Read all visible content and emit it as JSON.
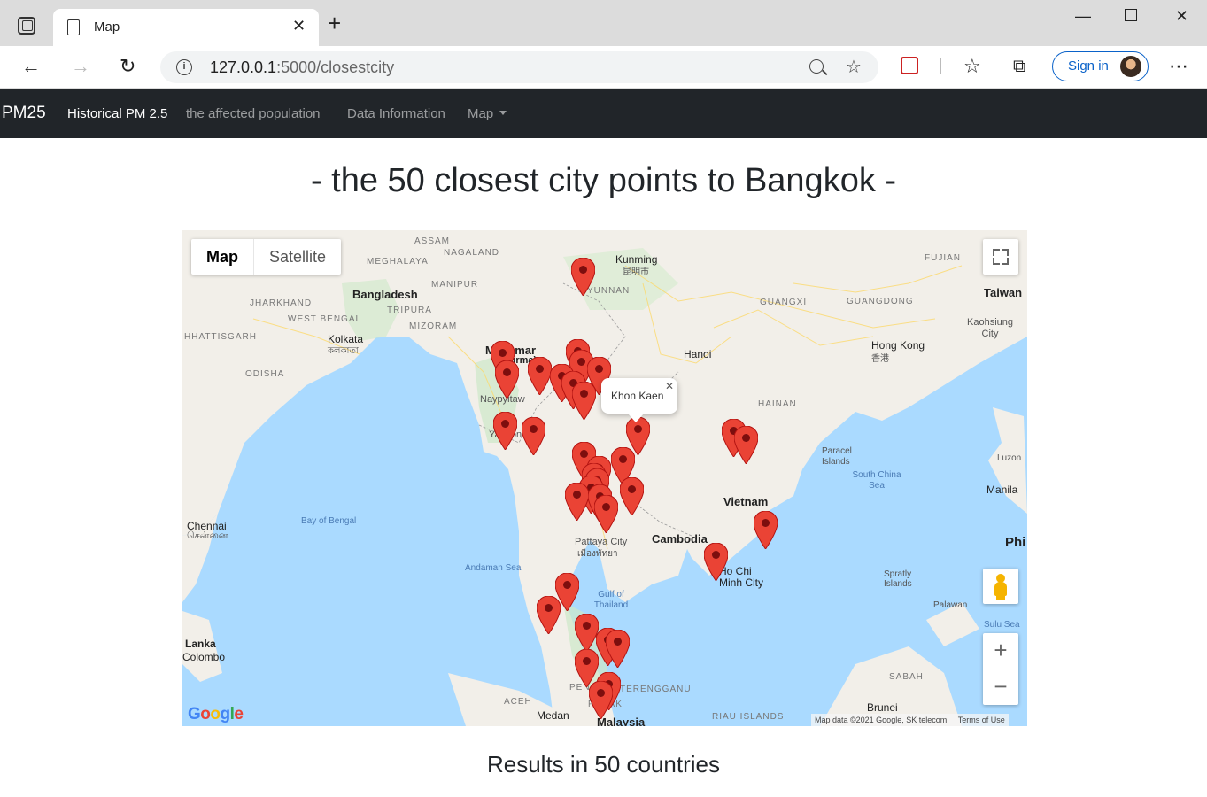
{
  "browser": {
    "tab_title": "Map",
    "url_host": "127.0.0.1",
    "url_path": ":5000/closestcity",
    "signin_label": "Sign in"
  },
  "navbar": {
    "brand": "PM25",
    "items": [
      {
        "label": "Historical PM 2.5",
        "active": true
      },
      {
        "label": "the affected population",
        "active": false
      },
      {
        "label": "Data Information",
        "active": false
      },
      {
        "label": "Map",
        "active": false,
        "dropdown": true
      }
    ]
  },
  "page": {
    "title": "- the 50 closest city points to Bangkok -",
    "results": "Results in 50 countries"
  },
  "map": {
    "type_buttons": {
      "map": "Map",
      "satellite": "Satellite"
    },
    "info_window": "Khon Kaen",
    "attribution": "Map data ©2021 Google, SK telecom",
    "terms": "Terms of Use",
    "labels": {
      "assam": "ASSAM",
      "nagaland": "NAGALAND",
      "meghalaya": "MEGHALAYA",
      "manipur": "MANIPUR",
      "bangladesh": "Bangladesh",
      "jharkhand": "JHARKHAND",
      "westbengal": "WEST BENGAL",
      "tripura": "TRIPURA",
      "mizoram": "MIZORAM",
      "chhattisgarh": "HHATTISGARH",
      "kolkata": "Kolkata",
      "kolkata_bn": "কলকাতা",
      "odisha": "ODISHA",
      "myanmar": "Myanmar",
      "burma": "(Burma)",
      "naypyitaw": "Naypyitaw",
      "yangon": "Yangon",
      "kunming": "Kunming",
      "kunming_zh": "昆明市",
      "yunnan": "YUNNAN",
      "guangxi": "GUANGXI",
      "guangdong": "GUANGDONG",
      "fujian": "FUJIAN",
      "taiwan": "Taiwan",
      "kaohsiung": "Kaohsiung City",
      "hongkong": "Hong Kong",
      "hongkong_zh": "香港",
      "hanoi": "Hanoi",
      "hainan": "HAINAN",
      "paracel": "Paracel Islands",
      "scs": "South China Sea",
      "luzon": "Luzon",
      "manila": "Manila",
      "vietnam": "Vietnam",
      "cambodia": "Cambodia",
      "pattaya": "Pattaya City",
      "pattaya_th": "เมืองพัทยา",
      "hcmc": "Ho Chi Minh City",
      "spratly": "Spratly Islands",
      "palawan": "Palawan",
      "sulu": "Sulu Sea",
      "phi": "Phi",
      "bayofbengal": "Bay of Bengal",
      "andaman": "Andaman Sea",
      "gulf": "Gulf of Thailand",
      "chennai": "Chennai",
      "chennai_ta": "சென்னை",
      "lanka": "Lanka",
      "colombo": "Colombo",
      "sabah": "SABAH",
      "brunei": "Brunei",
      "aceh": "ACEH",
      "medan": "Medan",
      "malaysia": "Malaysia",
      "penang": "PENANG",
      "terengganu": "TERENGGANU",
      "perak": "PERAK",
      "riau": "RIAU ISLANDS"
    }
  },
  "colors": {
    "navbar_bg": "#212529",
    "marker": "#ea4335",
    "water": "#aadaff",
    "land": "#f2efe9",
    "accent": "#0a62c9"
  }
}
